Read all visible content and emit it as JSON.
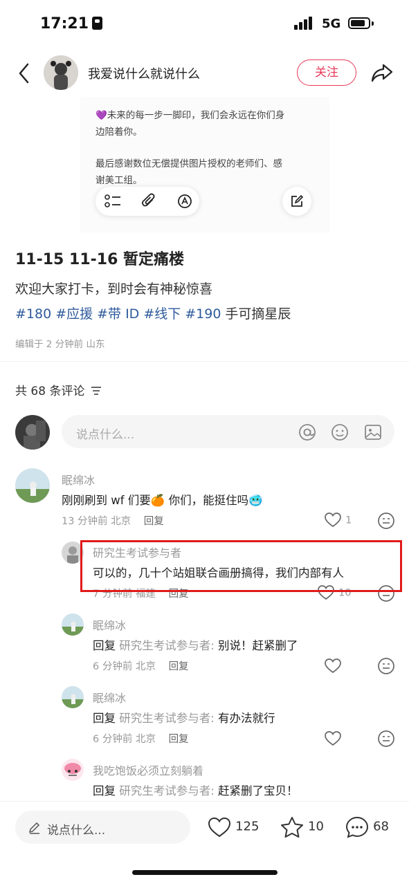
{
  "status_bar": {
    "time": "17:21",
    "network": "5G",
    "battery_level": 0.85
  },
  "header": {
    "username": "我爱说什么就说什么",
    "follow_label": "关注"
  },
  "image_text": {
    "line1": "💜未来的每一步一脚印，我们会永远在你们身",
    "line2": "边陪着你。",
    "line3": "最后感谢数位无偿提供图片授权的老师们、感",
    "line4": "谢美工组。"
  },
  "post": {
    "title": "11-15 11-16 暂定痛楼",
    "content": "欢迎大家打卡，到时会有神秘惊喜",
    "tags": [
      "#180",
      "#应援",
      "#带 ID",
      "#线下",
      "#190"
    ],
    "tags_tail": "手可摘星辰",
    "edited": "编辑于 2 分钟前 山东"
  },
  "comments_header": {
    "count_label": "共 68 条评论"
  },
  "comment_input": {
    "placeholder": "说点什么..."
  },
  "comments": [
    {
      "name": "眠绵冰",
      "text": "刚刚刷到 wf 们要🍊 你们，能挺住吗🥶",
      "meta": "13 分钟前 北京",
      "reply_label": "回复",
      "likes": "1"
    },
    {
      "name": "研究生考试参与者",
      "text": "可以的，几十个站姐联合画册搞得，我们内部有人",
      "meta": "7 分钟前 福建",
      "reply_label": "回复",
      "likes": "10"
    },
    {
      "name": "眠绵冰",
      "reply_prefix": "回复",
      "reply_to": "研究生考试参与者:",
      "text": " 别说！赶紧删了",
      "meta": "6 分钟前 北京",
      "reply_label": "回复"
    },
    {
      "name": "眠绵冰",
      "reply_prefix": "回复",
      "reply_to": "研究生考试参与者:",
      "text": " 有办法就行",
      "meta": "6 分钟前 北京",
      "reply_label": "回复"
    },
    {
      "name": "我吃饱饭必须立刻躺着",
      "reply_prefix": "回复",
      "reply_to": "研究生考试参与者:",
      "text": " 赶紧删了宝贝！"
    }
  ],
  "bottom_bar": {
    "placeholder": "说点什么...",
    "likes": "125",
    "stars": "10",
    "comments": "68"
  },
  "colors": {
    "accent": "#e8395a",
    "tag": "#2e5a9c",
    "highlight": "#e01a1a"
  }
}
